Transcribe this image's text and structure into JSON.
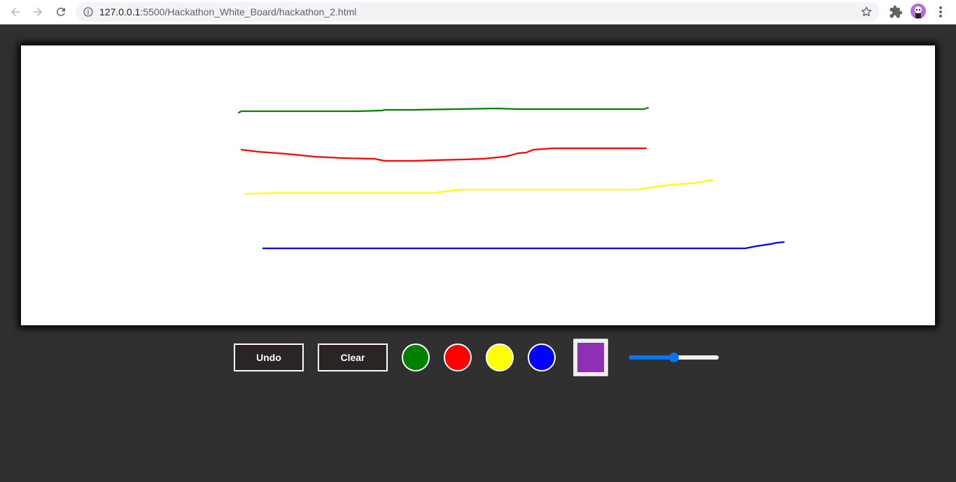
{
  "browser": {
    "url_host": "127.0.0.1",
    "url_rest": ":5500/Hackathon_White_Board/hackathon_2.html"
  },
  "toolbar": {
    "undo_label": "Undo",
    "clear_label": "Clear",
    "swatches": [
      {
        "name": "green",
        "color": "#008000"
      },
      {
        "name": "red",
        "color": "#ff0000"
      },
      {
        "name": "yellow",
        "color": "#ffff00"
      },
      {
        "name": "blue",
        "color": "#0000ff"
      }
    ],
    "picker_color": "#8e2fb6",
    "brush_size_fraction": 0.5
  },
  "strokes": [
    {
      "color": "#008000"
    },
    {
      "color": "#ff0000"
    },
    {
      "color": "#ffff00"
    },
    {
      "color": "#0000ff"
    }
  ]
}
